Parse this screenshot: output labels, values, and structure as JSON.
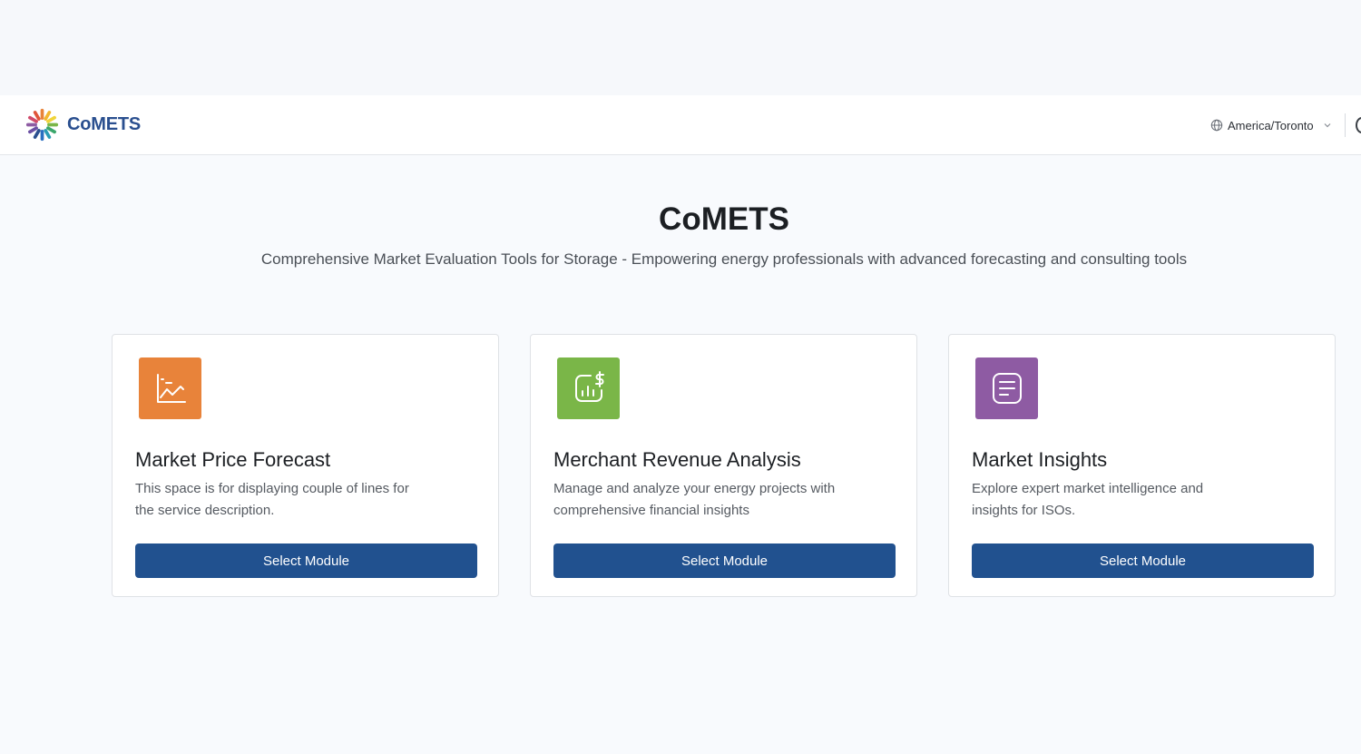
{
  "header": {
    "brand": "CoMETS",
    "timezone": "America/Toronto",
    "icons": {
      "logo": "comets-logo",
      "timezone": "globe-icon",
      "timezone_dropdown": "chevron-down-icon"
    }
  },
  "hero": {
    "title": "CoMETS",
    "subtitle": "Comprehensive Market Evaluation Tools for Storage - Empowering energy professionals with advanced forecasting and consulting tools"
  },
  "modules": [
    {
      "title": "Market Price Forecast",
      "description": "This space is for displaying couple of lines for the service description.",
      "button": "Select Module",
      "icon": "line-chart-icon",
      "color": "#e8833a"
    },
    {
      "title": "Merchant Revenue Analysis",
      "description": "Manage and analyze your energy projects with comprehensive financial insights",
      "button": "Select Module",
      "icon": "revenue-chart-icon",
      "color": "#7ab648"
    },
    {
      "title": "Market Insights",
      "description": "Explore expert market intelligence and insights for ISOs.",
      "button": "Select Module",
      "icon": "document-icon",
      "color": "#8e5ba3"
    }
  ],
  "colors": {
    "primary_button": "#21518f",
    "brand_text": "#2a4f8f",
    "page_background": "#f8fafd"
  }
}
